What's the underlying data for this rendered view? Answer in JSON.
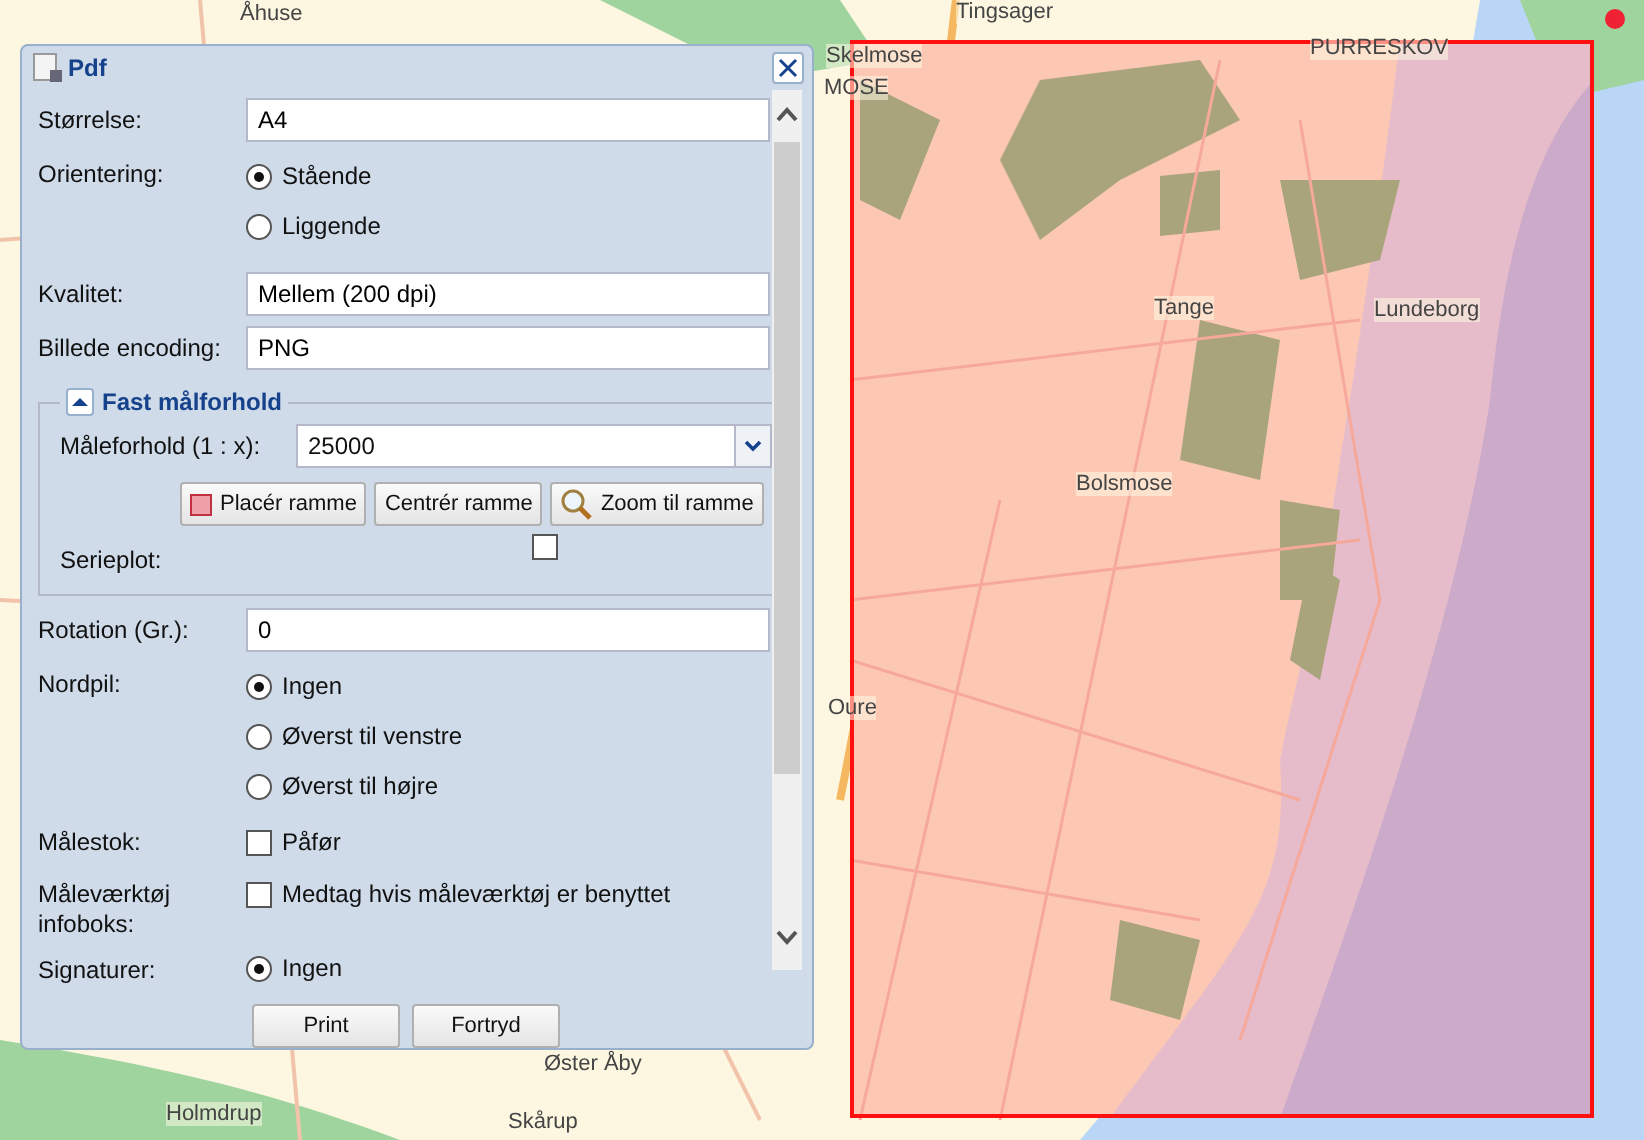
{
  "map": {
    "labels": [
      {
        "text": "Åhuse"
      },
      {
        "text": "Tingsager"
      },
      {
        "text": "Skelmose"
      },
      {
        "text": "MOSE"
      },
      {
        "text": "PURRESKOV"
      },
      {
        "text": "Tange"
      },
      {
        "text": "Lundeborg"
      },
      {
        "text": "Bolsmose"
      },
      {
        "text": "Oure"
      },
      {
        "text": "Øster Åby"
      },
      {
        "text": "Holmdrup"
      },
      {
        "text": "Skårup"
      }
    ]
  },
  "window": {
    "title": "Pdf"
  },
  "fields_top": [
    {
      "kind": "input",
      "label": "Størrelse:",
      "value": "A4"
    },
    {
      "kind": "radio",
      "label": "Orientering:",
      "options": [
        {
          "label": "Stående",
          "selected": true
        },
        {
          "label": "Liggende",
          "selected": false
        }
      ]
    },
    {
      "kind": "input",
      "label": "Kvalitet:",
      "value": "Mellem (200 dpi)"
    },
    {
      "kind": "input",
      "label": "Billede encoding:",
      "value": "PNG"
    }
  ],
  "fieldset": {
    "title": "Fast målforhold",
    "expanded": true,
    "scale": {
      "label": "Måleforhold (1 : x):",
      "value": "25000"
    },
    "buttons": [
      {
        "label": "Placér ramme",
        "kind": "marker"
      },
      {
        "label": "Centrér ramme",
        "kind": "plain"
      },
      {
        "label": "Zoom til ramme",
        "kind": "zoom"
      }
    ],
    "serieplot": {
      "label": "Serieplot:",
      "checked": false
    }
  },
  "fields_bottom": [
    {
      "kind": "input",
      "label": "Rotation (Gr.):",
      "value": "0"
    },
    {
      "kind": "radio",
      "label": "Nordpil:",
      "options": [
        {
          "label": "Ingen",
          "selected": true
        },
        {
          "label": "Øverst til venstre",
          "selected": false
        },
        {
          "label": "Øverst til højre",
          "selected": false
        }
      ]
    },
    {
      "kind": "checkbox",
      "label": "Målestok:",
      "text": "Påfør",
      "checked": false
    },
    {
      "kind": "checkbox",
      "label": "Måleværktøj infoboks:",
      "text": "Medtag hvis måleværktøj er benyttet",
      "checked": false
    },
    {
      "kind": "radio",
      "label": "Signaturer:",
      "options": [
        {
          "label": "Ingen",
          "selected": true
        }
      ]
    }
  ],
  "buttons": [
    "Print",
    "Fortryd"
  ]
}
